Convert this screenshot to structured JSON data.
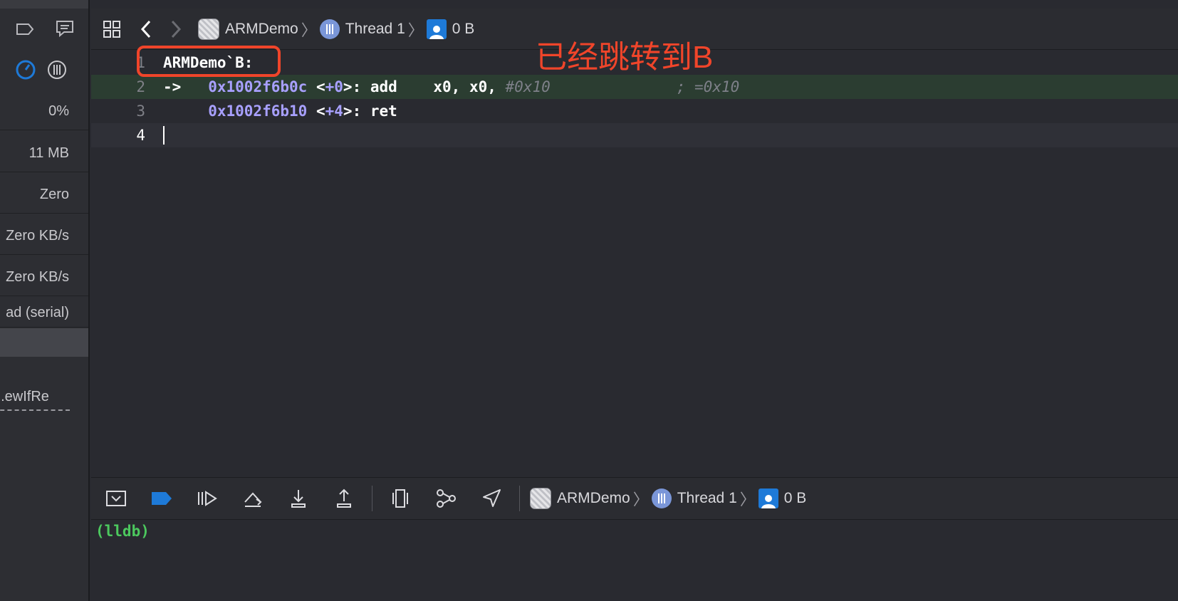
{
  "sidebar": {
    "cpu": "0%",
    "memory": "11 MB",
    "energy": "Zero",
    "disk": "Zero KB/s",
    "network": "Zero KB/s",
    "queue": "ad (serial)",
    "frame": "ewIfRe..."
  },
  "jumpbar": {
    "app": "ARMDemo",
    "thread": "Thread 1",
    "frame": "0 B"
  },
  "annotation": {
    "text": "已经跳转到B",
    "color": "#f0452a"
  },
  "code": {
    "lines": [
      {
        "number": "1",
        "label": "ARMDemo`B:"
      },
      {
        "number": "2",
        "marker": "->",
        "address": "0x1002f6b0c",
        "offset_prefix": "<",
        "offset": "+0",
        "offset_suffix": ">",
        "instruction": ": add    x0, x0, ",
        "operand_comment": "#0x10",
        "comment": "; =0x10"
      },
      {
        "number": "3",
        "address": "0x1002f6b10",
        "offset_prefix": "<",
        "offset": "+4",
        "offset_suffix": ">",
        "instruction": ": ret"
      },
      {
        "number": "4"
      }
    ]
  },
  "debugbar": {
    "app": "ARMDemo",
    "thread": "Thread 1",
    "frame": "0 B",
    "buttons": [
      "hide-console",
      "breakpoints-toggle",
      "continue",
      "step-over",
      "step-into",
      "step-out",
      "view-hierarchy",
      "memory-graph",
      "simulate-location"
    ]
  },
  "console": {
    "prompt": "(lldb)"
  },
  "colors": {
    "accent": "#1e7ad8",
    "pc_highlight": "#2b3d31",
    "address": "#a8a0ff",
    "lldb_prompt": "#4cc85e"
  }
}
